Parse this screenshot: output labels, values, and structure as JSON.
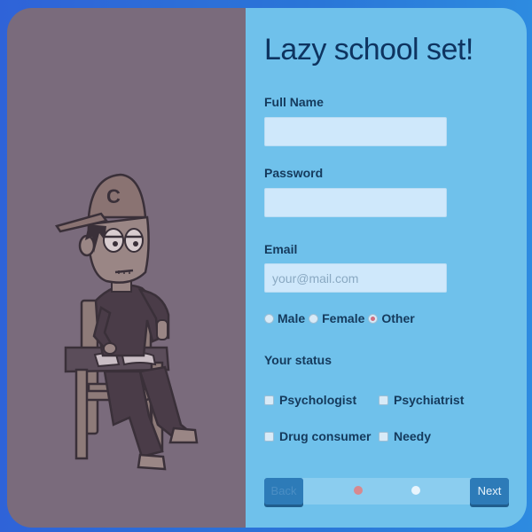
{
  "form": {
    "title": "Lazy school set!",
    "fullname_label": "Full Name",
    "fullname_value": "",
    "password_label": "Password",
    "password_value": "",
    "email_label": "Email",
    "email_placeholder": "your@mail.com",
    "gender_options": [
      "Male",
      "Female",
      "Other"
    ],
    "gender_selected": "Other",
    "status_label": "Your status",
    "status_options": [
      "Psychologist",
      "Psychiatrist",
      "Drug consumer",
      "Needy"
    ]
  },
  "nav": {
    "back_label": "Back",
    "next_label": "Next",
    "step_dots": 2,
    "current_step": 1
  },
  "colors": {
    "left_panel": "#7a6b7c",
    "right_panel": "#6fc1eb",
    "title": "#0e3460",
    "button": "#2d7bb8",
    "active_dot": "#d7898f",
    "inactive_dot": "#e9f5fd"
  }
}
